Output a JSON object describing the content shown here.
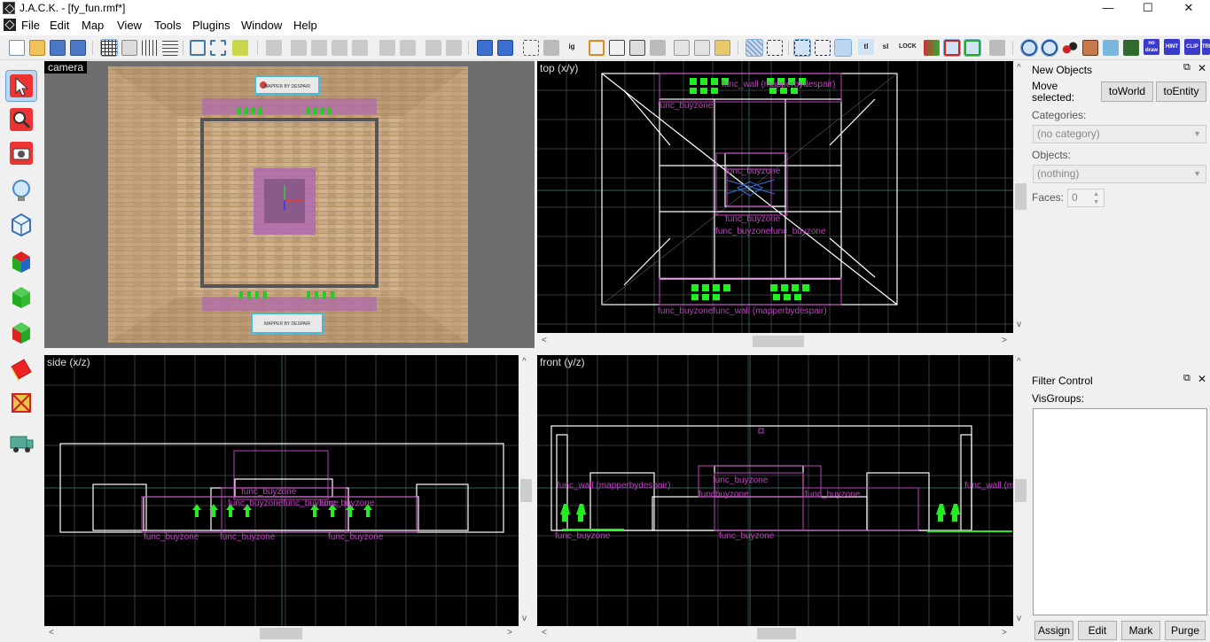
{
  "window": {
    "title": "J.A.C.K. - [fy_fun.rmf*]",
    "controls": [
      "—",
      "☐",
      "✕"
    ]
  },
  "menu": {
    "items": [
      "File",
      "Edit",
      "Map",
      "View",
      "Tools",
      "Plugins",
      "Window",
      "Help"
    ],
    "mdi_controls": [
      "–",
      "⧉",
      "✕"
    ]
  },
  "toolbar": {
    "text_buttons": {
      "ig": "ig",
      "tl": "tl",
      "sl": "sl",
      "lock": "LOCK",
      "nodraw": "no draw",
      "hint": "HINT",
      "clip": "CLIP",
      "trig": "TRIG"
    }
  },
  "left_tools": [
    "selection-tool",
    "magnify-tool",
    "camera-tool",
    "entity-tool",
    "block-tool",
    "texture-application-tool",
    "apply-texture-tool",
    "replace-texture-tool",
    "decal-tool",
    "overlay-tool",
    "path-tool"
  ],
  "viewports": {
    "camera": {
      "label": "camera"
    },
    "top": {
      "label": "top (x/y)",
      "entity_labels": [
        "func_wall (mapperbydespair)",
        "func_buyzone",
        "func_buyzone",
        "func_buyzone",
        "func_buyzonefunc_buyzone",
        "func_buyzonefunc_wall (mapperbydespair)"
      ]
    },
    "side": {
      "label": "side (x/z)",
      "entity_labels": [
        "func_buyzone",
        "func_buyzone",
        "func_buyzone",
        "func_buyzone",
        "func_buyzonefunc_buyzone",
        "func_buyzone"
      ]
    },
    "front": {
      "label": "front (y/z)",
      "entity_labels": [
        "func_wall (mapperbydespair)",
        "func_buyzone",
        "funcbuyzone",
        "func_buyzone",
        "func_buyzone",
        "func_buyzone",
        "func_wall (m"
      ]
    },
    "camera_signs": {
      "top": "MAPPER BY DESPAIR",
      "bottom": "MAPPER BY DESPAIR"
    }
  },
  "new_objects": {
    "title": "New Objects",
    "move_selected_label": "Move selected:",
    "to_world": "toWorld",
    "to_entity": "toEntity",
    "categories_label": "Categories:",
    "categories_value": "(no category)",
    "objects_label": "Objects:",
    "objects_value": "(nothing)",
    "faces_label": "Faces:",
    "faces_value": "0"
  },
  "filter_control": {
    "title": "Filter Control",
    "visgroups_label": "VisGroups:",
    "buttons": [
      "Assign",
      "Edit",
      "Mark",
      "Purge"
    ]
  },
  "colors": {
    "grid": "#3a3a3a",
    "brush": "#ffffff",
    "entity": "#c040c0",
    "spawn": "#22ee22",
    "selection": "#3a6ad8"
  }
}
